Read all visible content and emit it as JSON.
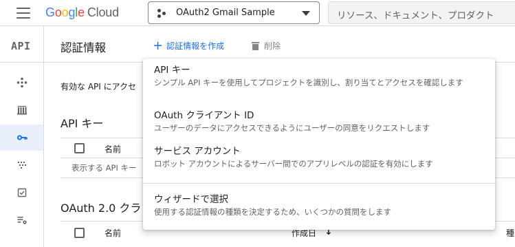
{
  "header": {
    "logo_google": "Google",
    "logo_cloud": "Cloud",
    "project_name": "OAuth2 Gmail Sample",
    "search_placeholder": "リソース、ドキュメント、プロダクト"
  },
  "rail": {
    "api_label": "API",
    "items": [
      {
        "icon": "dashboard-icon"
      },
      {
        "icon": "library-icon"
      },
      {
        "icon": "key-icon",
        "active": true
      },
      {
        "icon": "consent-screen-icon"
      },
      {
        "icon": "domain-verification-icon"
      },
      {
        "icon": "page-usage-settings-icon"
      }
    ]
  },
  "page": {
    "title": "認証情報",
    "create_label": "認証情報を作成",
    "delete_label": "削除",
    "info_text": "有効な API にアクセ",
    "api_keys_title": "API キー",
    "name_col": "名前",
    "empty_api_keys": "表示する API キー",
    "oauth_title": "OAuth 2.0 クラ",
    "oauth_name_col": "名前",
    "created_col": "作成日",
    "type_col": "種"
  },
  "menu": {
    "items": [
      {
        "title": "API キー",
        "desc": "シンプル API キーを使用してプロジェクトを識別し、割り当てとアクセスを確認します"
      },
      {
        "title": "OAuth クライアント ID",
        "desc": "ユーザーのデータにアクセスできるようにユーザーの同意をリクエストします"
      },
      {
        "title": "サービス アカウント",
        "desc": "ロボット アカウントによるサーバー間でのアプリレベルの認証を有効にします"
      },
      {
        "title": "ウィザードで選択",
        "desc": "使用する認証情報の種類を決定するため、いくつかの質問をします"
      }
    ]
  },
  "colors": {
    "google_blue": "#4285F4",
    "google_red": "#EA4335",
    "google_yellow": "#FBBC05",
    "google_green": "#34A853",
    "accent": "#1a73e8",
    "active_rail_bg": "#e8f0fe"
  }
}
